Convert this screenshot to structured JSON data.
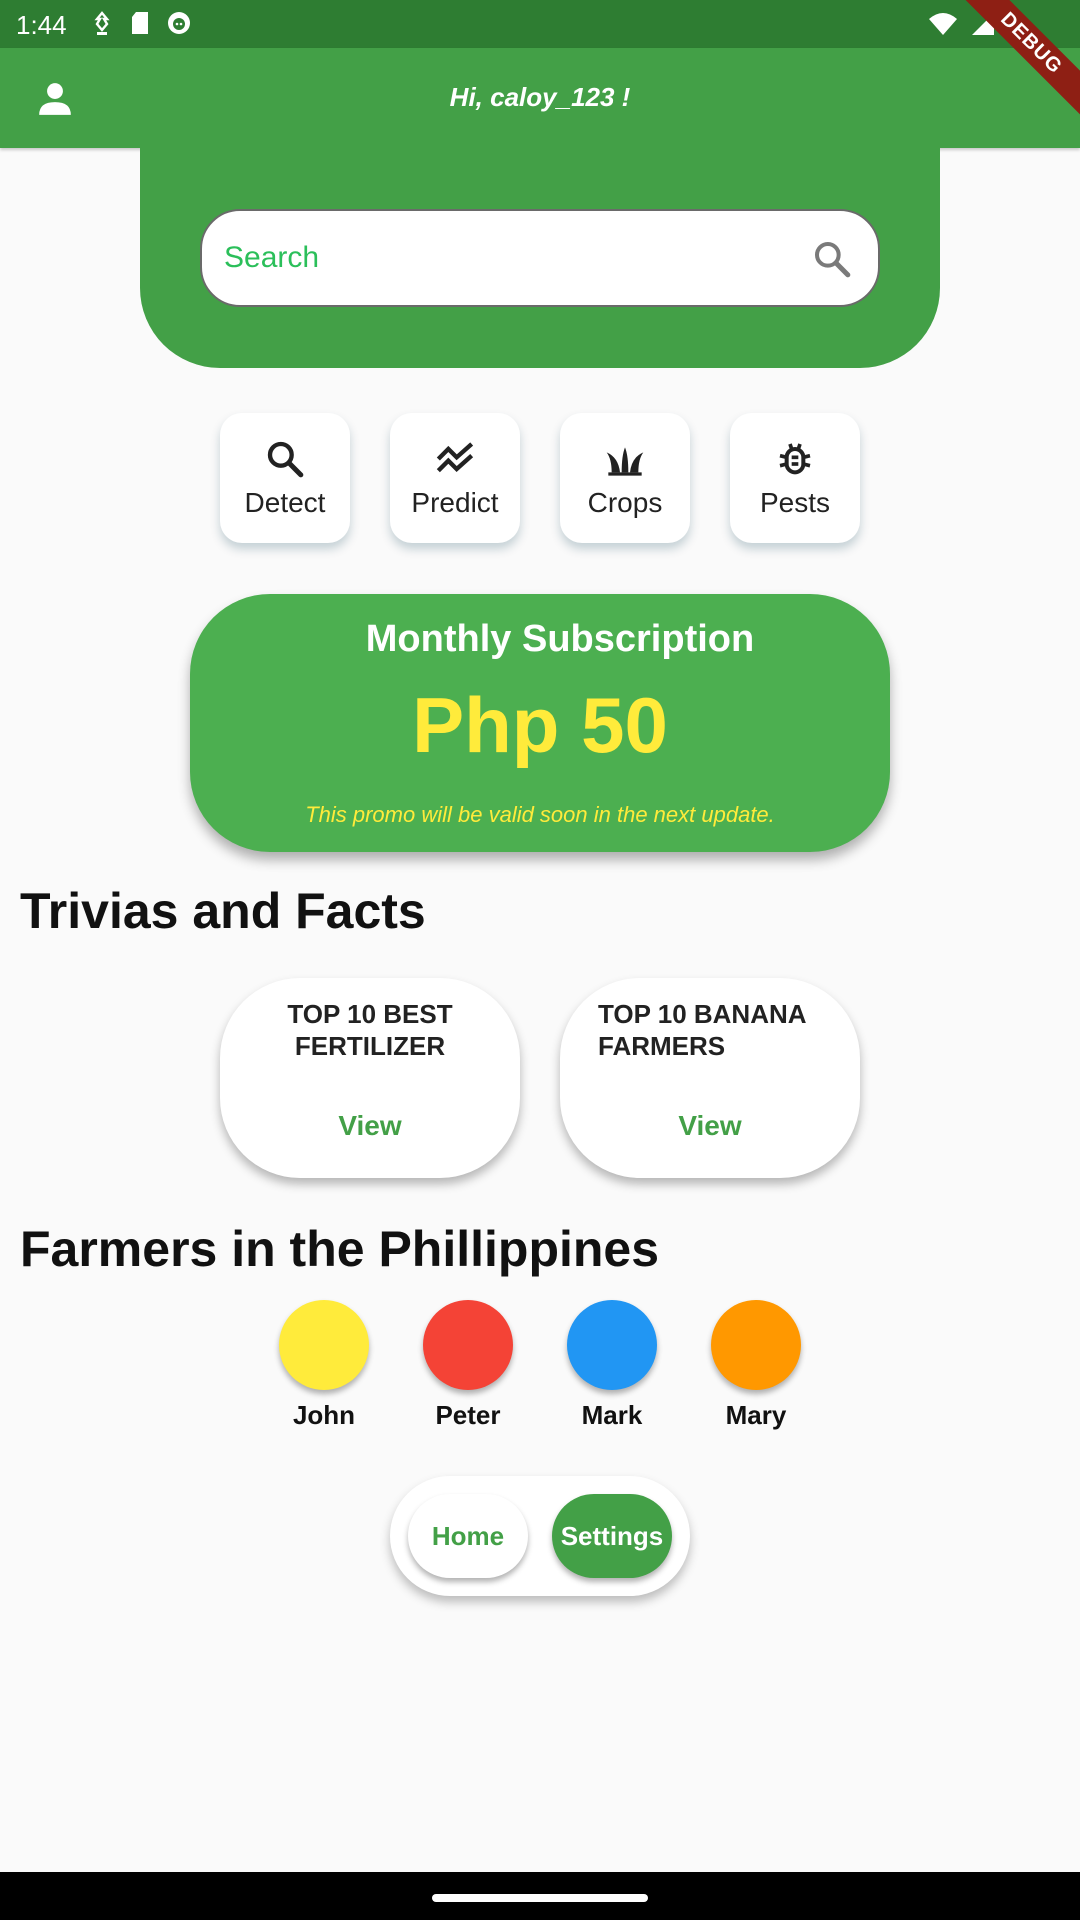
{
  "status_bar": {
    "time": "1:44",
    "left_icons": [
      "download-arrow-icon",
      "sd-card-icon",
      "face-icon"
    ],
    "right_icons": [
      "wifi-icon",
      "signal-icon",
      "battery-icon"
    ]
  },
  "debug_banner": "DEBUG",
  "app_bar": {
    "greeting": "Hi, caloy_123 !",
    "profile_icon": "person-icon"
  },
  "search": {
    "placeholder": "Search",
    "icon": "search-icon"
  },
  "quick_actions": [
    {
      "label": "Detect",
      "icon": "search-icon"
    },
    {
      "label": "Predict",
      "icon": "trend-icon"
    },
    {
      "label": "Crops",
      "icon": "crops-icon"
    },
    {
      "label": "Pests",
      "icon": "bug-icon"
    }
  ],
  "subscription": {
    "title": "Monthly Subscription",
    "price": "Php 50",
    "note": "This promo will be valid soon in the next update."
  },
  "trivia": {
    "heading": "Trivias and Facts",
    "cards": [
      {
        "title": "TOP 10 BEST FERTILIZER",
        "action": "View"
      },
      {
        "title": "TOP 10 BANANA FARMERS",
        "action": "View"
      }
    ]
  },
  "farmers": {
    "heading": "Farmers in the Phillippines",
    "people": [
      {
        "name": "John",
        "color": "#ffeb3b"
      },
      {
        "name": "Peter",
        "color": "#f44336"
      },
      {
        "name": "Mark",
        "color": "#2196f3"
      },
      {
        "name": "Mary",
        "color": "#ff9800"
      }
    ]
  },
  "bottom_nav": {
    "home": "Home",
    "settings": "Settings"
  },
  "colors": {
    "primary": "#43a047",
    "status_bar": "#2e7d32",
    "accent_yellow": "#ffeb3b"
  }
}
